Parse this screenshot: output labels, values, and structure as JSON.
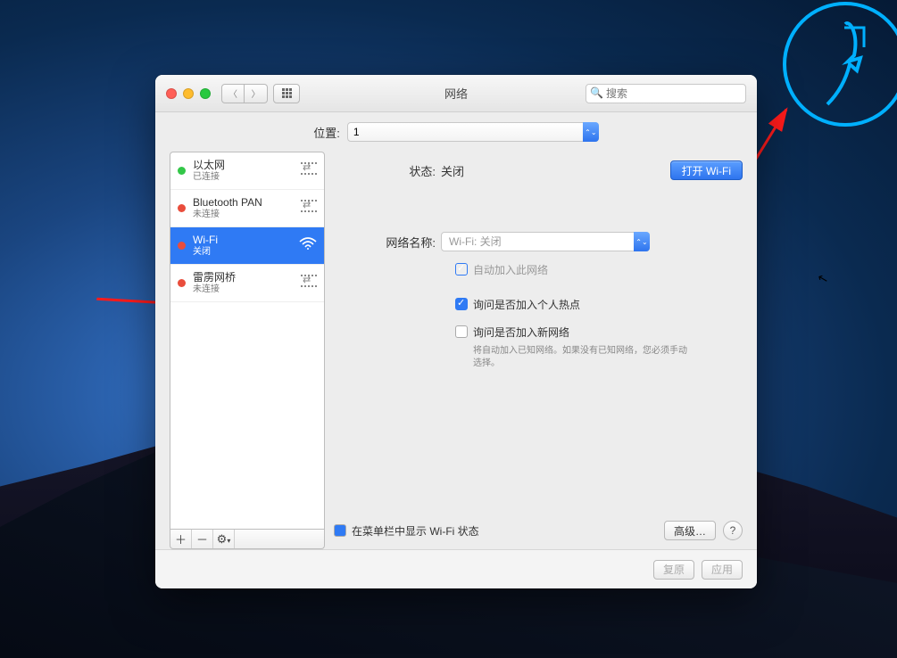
{
  "titlebar": {
    "title": "网络",
    "search_placeholder": "搜索"
  },
  "location": {
    "label": "位置:",
    "value": "1"
  },
  "sidebar": {
    "services": [
      {
        "name": "以太网",
        "status": "已连接",
        "dot": "green"
      },
      {
        "name": "Bluetooth PAN",
        "status": "未连接",
        "dot": "red"
      },
      {
        "name": "Wi-Fi",
        "status": "关闭",
        "dot": "red",
        "selected": true
      },
      {
        "name": "雷雳网桥",
        "status": "未连接",
        "dot": "red"
      }
    ],
    "toolbar": {
      "add": "＋",
      "remove": "－",
      "gear": "⚙"
    }
  },
  "detail": {
    "status_label": "状态:",
    "status_value": "关闭",
    "open_wifi": "打开 Wi-Fi",
    "network_name_label": "网络名称:",
    "network_name_placeholder": "Wi-Fi: 关闭",
    "auto_join": "自动加入此网络",
    "ask_hotspot": "询问是否加入个人热点",
    "ask_new": "询问是否加入新网络",
    "help_text": "将自动加入已知网络。如果没有已知网络，您必须手动选择。",
    "show_menubar": "在菜单栏中显示 Wi-Fi 状态",
    "advanced": "高级…",
    "help": "?"
  },
  "footer": {
    "revert": "复原",
    "apply": "应用"
  }
}
